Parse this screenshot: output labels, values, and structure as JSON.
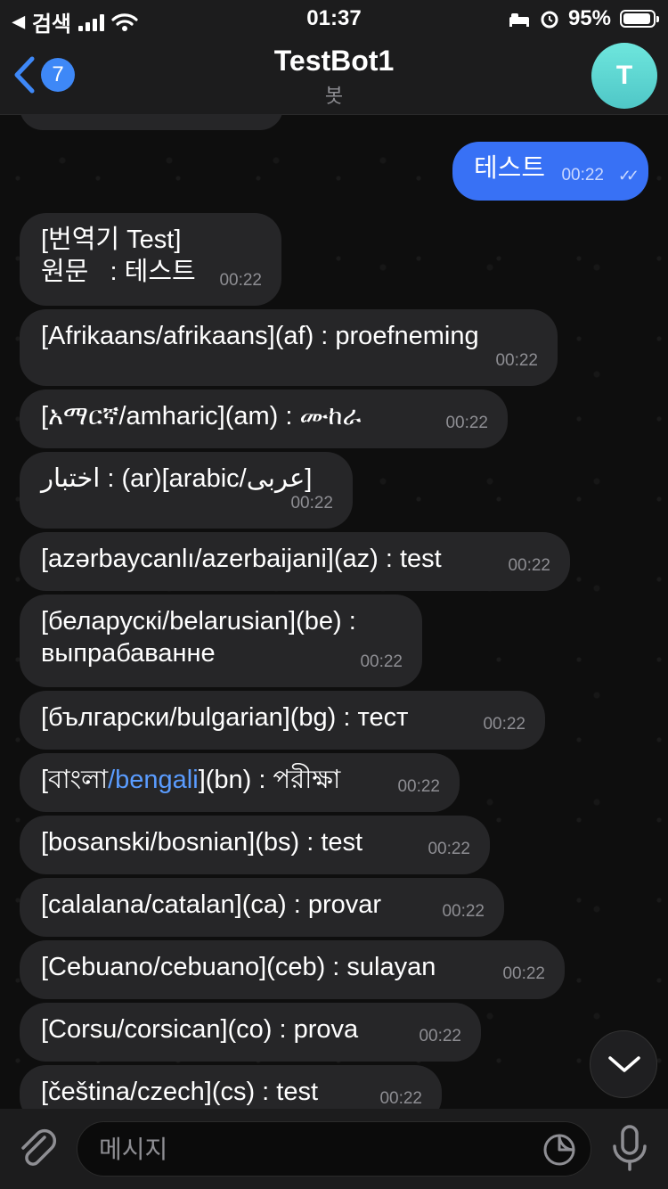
{
  "status_bar": {
    "back_app": "검색",
    "time": "01:37",
    "battery": "95%",
    "battery_level": 0.95
  },
  "header": {
    "back_count": "7",
    "title": "TestBot1",
    "subtitle": "봇",
    "avatar_letter": "T"
  },
  "messages": [
    {
      "text": "테스트",
      "time": "00:22",
      "outgoing": true
    },
    {
      "text": "[번역기 Test]\n원문   : 테스트",
      "time": "00:22"
    },
    {
      "text": "[Afrikaans/afrikaans](af) : proefneming",
      "time": "00:22"
    },
    {
      "text": "[አማርኛ/amharic](am) : ሙከራ",
      "time": "00:22"
    },
    {
      "text": "[عربى/arabic](ar) : اختبار",
      "time": "00:22"
    },
    {
      "text": "[azərbaycanlı/azerbaijani](az) : test",
      "time": "00:22"
    },
    {
      "text": "[беларускі/belarusian](be) :\nвыпрабаванне",
      "time": "00:22"
    },
    {
      "text": "[български/bulgarian](bg) : тест",
      "time": "00:22"
    },
    {
      "text_before": "[বাংলা",
      "link": "/bengali",
      "text_after": "](bn) : পরীক্ষা",
      "time": "00:22"
    },
    {
      "text": "[bosanski/bosnian](bs) : test",
      "time": "00:22"
    },
    {
      "text": "[calalana/catalan](ca) : provar",
      "time": "00:22"
    },
    {
      "text": "[Cebuano/cebuano](ceb) : sulayan",
      "time": "00:22"
    },
    {
      "text": "[Corsu/corsican](co) : prova",
      "time": "00:22"
    },
    {
      "text": "[čeština/czech](cs) : test",
      "time": "00:22"
    }
  ],
  "input": {
    "placeholder": "메시지"
  },
  "icons": {
    "back": "chevron-left-icon",
    "attach": "paperclip-icon",
    "sticker": "sticker-icon",
    "mic": "microphone-icon",
    "scroll_down": "chevron-down-icon",
    "read_receipt": "double-check-icon"
  },
  "colors": {
    "accent": "#3e88f7",
    "outgoing_bubble": "#3871f5",
    "incoming_bubble": "#262628",
    "link": "#5a9cff",
    "avatar": "#5fd6d2"
  }
}
